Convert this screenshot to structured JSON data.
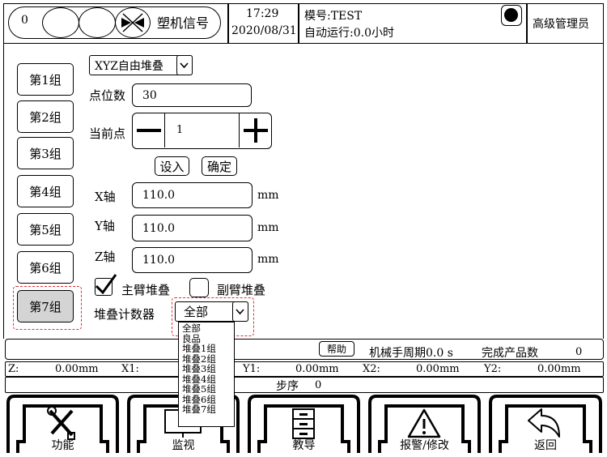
{
  "header": {
    "signal_count": "0",
    "signal_title": "塑机信号",
    "time": "17:29",
    "date": "2020/08/31",
    "mold_label": "模号:",
    "mold_value": "TEST",
    "auto_run_label": "自动运行:",
    "auto_run_value": "0.0小时",
    "user_role": "高级管理员"
  },
  "groups": [
    {
      "label": "第1组"
    },
    {
      "label": "第2组"
    },
    {
      "label": "第3组"
    },
    {
      "label": "第4组"
    },
    {
      "label": "第5组"
    },
    {
      "label": "第6组"
    },
    {
      "label": "第7组"
    }
  ],
  "active_group_index": 6,
  "stack": {
    "mode_value": "XYZ自由堆叠",
    "points_label": "点位数",
    "points_value": "30",
    "current_label": "当前点",
    "current_value": "1",
    "minus": "−",
    "plus": "+",
    "set_in_label": "设入",
    "confirm_label": "确定",
    "x_label": "X轴",
    "x_value": "110.0",
    "y_label": "Y轴",
    "y_value": "110.0",
    "z_label": "Z轴",
    "z_value": "110.0",
    "unit": "mm",
    "main_arm_label": "主臂堆叠",
    "main_arm_checked": true,
    "sub_arm_label": "副臂堆叠",
    "sub_arm_checked": false,
    "counter_label": "堆叠计数器",
    "counter_value": "全部",
    "counter_options": [
      "全部",
      "良品",
      "堆叠1组",
      "堆叠2组",
      "堆叠3组",
      "堆叠4组",
      "堆叠5组",
      "堆叠6组",
      "堆叠7组"
    ]
  },
  "status": {
    "help_label": "帮助",
    "cycle_label": "机械手周期",
    "cycle_value": "0.0 s",
    "products_label": "完成产品数",
    "products_value": "0",
    "z_label": "Z:",
    "z_value": "0.00mm",
    "x1_label": "X1:",
    "y1_label": "Y1:",
    "y1_value": "0.00mm",
    "x2_label": "X2:",
    "x2_value": "0.00mm",
    "y2_label": "Y2:",
    "y2_value": "0.00mm",
    "step_label": "步序",
    "step_value": "0"
  },
  "nav": [
    {
      "label": "功能",
      "icon": "tools-icon"
    },
    {
      "label": "监视",
      "icon": "monitor-icon"
    },
    {
      "label": "教导",
      "icon": "cabinet-icon"
    },
    {
      "label": "报警/修改",
      "icon": "warning-icon"
    },
    {
      "label": "返回",
      "icon": "return-arrow-icon"
    }
  ]
}
